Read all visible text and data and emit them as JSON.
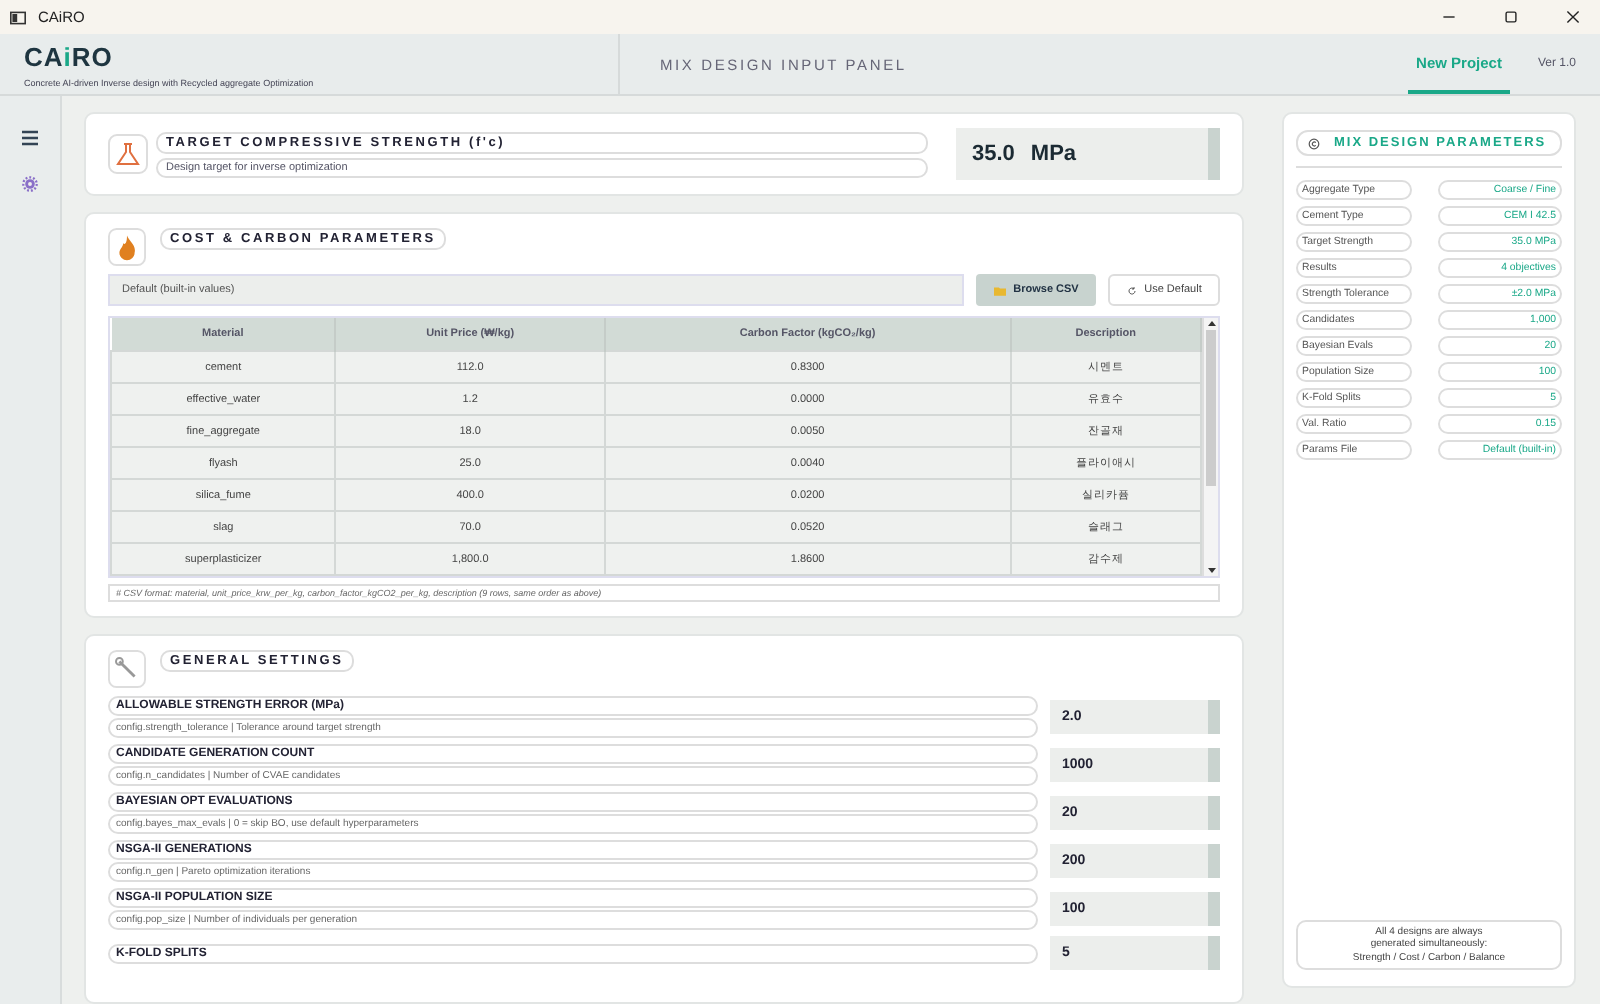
{
  "window": {
    "title": "CAiRO"
  },
  "header": {
    "logo": [
      {
        "text": "CA",
        "accent": false
      },
      {
        "text": "i",
        "accent": true
      },
      {
        "text": "RO",
        "accent": false
      }
    ],
    "tagline": "Concrete AI-driven Inverse design with Recycled aggregate Optimization",
    "panel_title": "MIX DESIGN INPUT PANEL",
    "tabs": [
      {
        "label": "New Project",
        "selected": true
      }
    ],
    "version": "Ver 1.0"
  },
  "target": {
    "title": "TARGET COMPRESSIVE STRENGTH (f'c)",
    "subtitle": "Design target for inverse optimization",
    "value": "35.0",
    "unit": "MPa"
  },
  "cost": {
    "title": "COST & CARBON PARAMETERS",
    "file_field": "Default (built-in values)",
    "browse": "Browse CSV",
    "use_default": "Use Default",
    "table": {
      "columns": [
        "Material",
        "Unit Price (₩/kg)",
        "Carbon Factor (kgCO₂/kg)",
        "Description"
      ],
      "rows": [
        [
          "cement",
          "112.0",
          "0.8300",
          "시멘트"
        ],
        [
          "effective_water",
          "1.2",
          "0.0000",
          "유효수"
        ],
        [
          "fine_aggregate",
          "18.0",
          "0.0050",
          "잔골재"
        ],
        [
          "flyash",
          "25.0",
          "0.0040",
          "플라이애시"
        ],
        [
          "silica_fume",
          "400.0",
          "0.0200",
          "실리카퓸"
        ],
        [
          "slag",
          "70.0",
          "0.0520",
          "슬래그"
        ],
        [
          "superplasticizer",
          "1,800.0",
          "1.8600",
          "감수제"
        ]
      ]
    },
    "note": "#  CSV format: material, unit_price_krw_per_kg, carbon_factor_kgCO2_per_kg, description  (9 rows, same order as above)"
  },
  "general": {
    "title": "GENERAL SETTINGS",
    "settings": [
      {
        "label": "ALLOWABLE STRENGTH ERROR (MPa)",
        "hint": "config.strength_tolerance  |  Tolerance around target strength",
        "value": "2.0"
      },
      {
        "label": "CANDIDATE GENERATION COUNT",
        "hint": "config.n_candidates  |  Number of CVAE candidates",
        "value": "1000"
      },
      {
        "label": "BAYESIAN OPT EVALUATIONS",
        "hint": "config.bayes_max_evals  |  0 = skip BO, use default hyperparameters",
        "value": "20"
      },
      {
        "label": "NSGA-II GENERATIONS",
        "hint": "config.n_gen  |  Pareto optimization iterations",
        "value": "200"
      },
      {
        "label": "NSGA-II POPULATION SIZE",
        "hint": "config.pop_size  |  Number of individuals per generation",
        "value": "100"
      },
      {
        "label": "K-FOLD SPLITS",
        "value": "5"
      }
    ]
  },
  "summary": {
    "title": "MIX DESIGN PARAMETERS",
    "rows": [
      {
        "label": "Aggregate Type",
        "value": "Coarse / Fine"
      },
      {
        "label": "Cement Type",
        "value": "CEM I 42.5"
      },
      {
        "label": "Target Strength",
        "value": "35.0 MPa"
      },
      {
        "label": "Results",
        "value": "4 objectives"
      },
      {
        "label": "Strength Tolerance",
        "value": "±2.0 MPa"
      },
      {
        "label": "Candidates",
        "value": "1,000"
      },
      {
        "label": "Bayesian Evals",
        "value": "20"
      },
      {
        "label": "Population Size",
        "value": "100"
      },
      {
        "label": "K-Fold Splits",
        "value": "5"
      },
      {
        "label": "Val. Ratio",
        "value": "0.15"
      },
      {
        "label": "Params File",
        "value": "Default (built-in)"
      }
    ],
    "note": [
      "All 4 designs are always",
      "generated simultaneously:",
      "Strength / Cost / Carbon / Balance"
    ]
  }
}
